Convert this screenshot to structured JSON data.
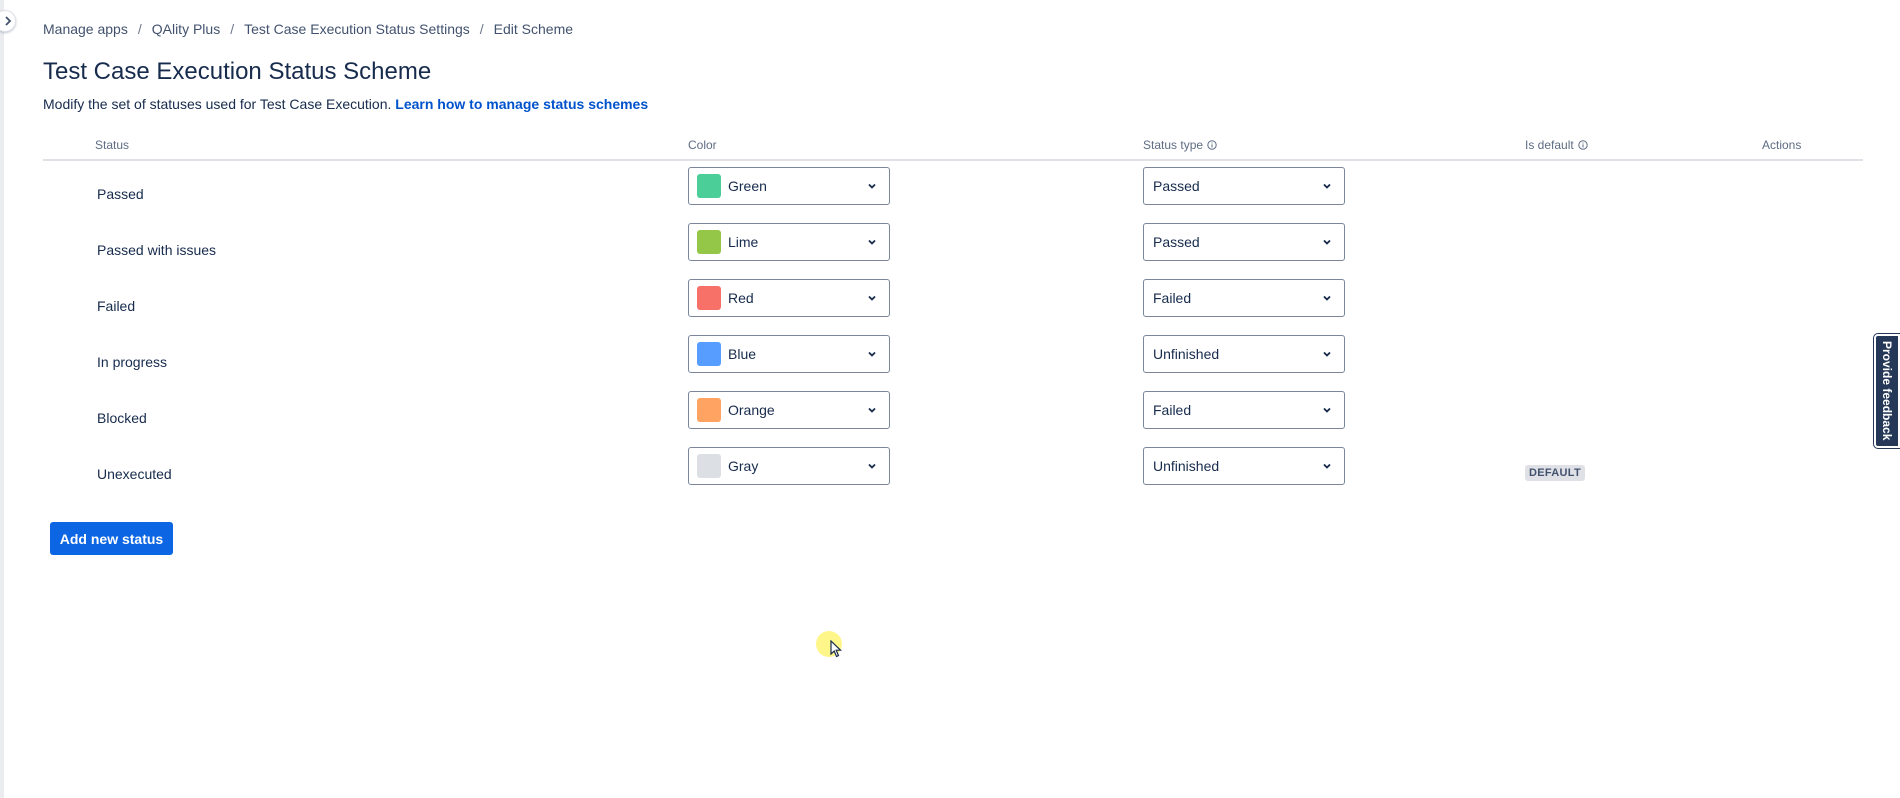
{
  "breadcrumb": [
    "Manage apps",
    "QAlity Plus",
    "Test Case Execution Status Settings",
    "Edit Scheme"
  ],
  "breadcrumb_separator": "/",
  "page": {
    "title": "Test Case Execution Status Scheme",
    "description": "Modify the set of statuses used for Test Case Execution.",
    "learn_link": "Learn how to manage status schemes"
  },
  "table": {
    "headers": {
      "status": "Status",
      "color": "Color",
      "status_type": "Status type",
      "is_default": "Is default",
      "actions": "Actions"
    },
    "rows": [
      {
        "status": "Passed",
        "color": "Green",
        "color_hex": "#4bce97",
        "status_type": "Passed",
        "is_default": false
      },
      {
        "status": "Passed with issues",
        "color": "Lime",
        "color_hex": "#94c748",
        "status_type": "Passed",
        "is_default": false
      },
      {
        "status": "Failed",
        "color": "Red",
        "color_hex": "#f87168",
        "status_type": "Failed",
        "is_default": false
      },
      {
        "status": "In progress",
        "color": "Blue",
        "color_hex": "#579dff",
        "status_type": "Unfinished",
        "is_default": false
      },
      {
        "status": "Blocked",
        "color": "Orange",
        "color_hex": "#fea362",
        "status_type": "Failed",
        "is_default": false
      },
      {
        "status": "Unexecuted",
        "color": "Gray",
        "color_hex": "#dcdfe4",
        "status_type": "Unfinished",
        "is_default": true,
        "default_badge": "DEFAULT"
      }
    ]
  },
  "add_button": "Add new status",
  "feedback_tab": "Provide feedback",
  "icons": {
    "expand": "chevron-right-icon",
    "info": "info-icon",
    "dropdown": "chevron-down-icon",
    "cursor": "mouse-pointer-icon"
  },
  "colors": {
    "primary": "#0c66e4",
    "link": "#0052cc",
    "text": "#172b4d",
    "feedback": "#253858"
  }
}
